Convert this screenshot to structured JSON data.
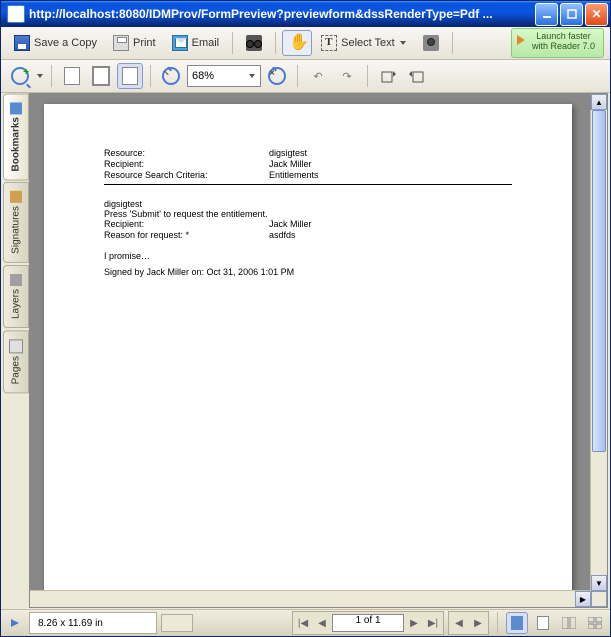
{
  "window": {
    "title": "http://localhost:8080/IDMProv/FormPreview?previewform&dssRenderType=Pdf ..."
  },
  "toolbar": {
    "save": "Save a Copy",
    "print": "Print",
    "email": "Email",
    "select_text": "Select Text",
    "launch_line1": "Launch faster",
    "launch_line2": "with Reader 7.0"
  },
  "toolbar2": {
    "zoom": "68%"
  },
  "side_tabs": {
    "bookmarks": "Bookmarks",
    "signatures": "Signatures",
    "layers": "Layers",
    "pages": "Pages"
  },
  "doc": {
    "resource_label": "Resource:",
    "resource_value": "digsigtest",
    "recipient_label": "Recipient:",
    "recipient_value": "Jack Miller",
    "search_label": "Resource Search Criteria:",
    "search_value": "Entitlements",
    "title": "digsigtest",
    "instruction": "Press 'Submit' to request the entitlement.",
    "recipient2_label": "Recipient:",
    "recipient2_value": "Jack Miller",
    "reason_label": "Reason for request: *",
    "reason_value": "asdfds",
    "promise": "I promise…",
    "signed": "Signed by Jack Miller on: Oct 31, 2006 1:01 PM"
  },
  "status": {
    "dimensions": "8.26 x 11.69 in",
    "page": "1 of 1"
  }
}
